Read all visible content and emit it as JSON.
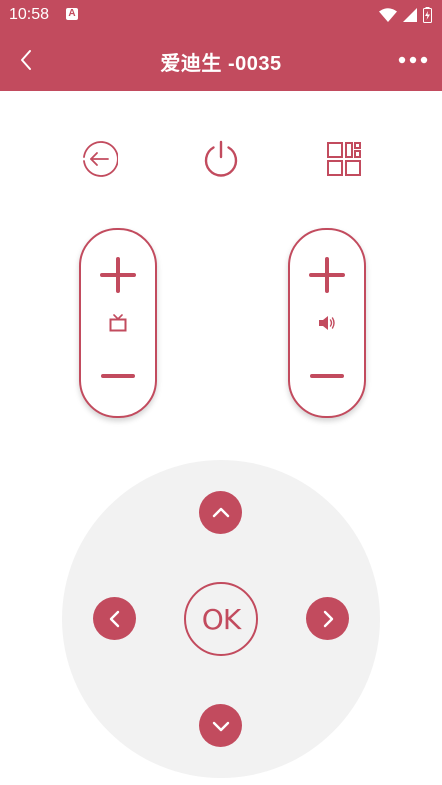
{
  "theme": {
    "accent": "#c24b5e",
    "background": "#ffffff",
    "dpad_background": "#f2f2f2"
  },
  "status_bar": {
    "time": "10:58",
    "notification_icon": "a-icon",
    "indicator_icons": [
      "wifi-icon",
      "signal-icon",
      "battery-icon"
    ]
  },
  "header": {
    "back_icon": "chevron-left-icon",
    "title": "爱迪生 -0035",
    "more_icon": "more-horizontal-icon"
  },
  "top_controls": [
    {
      "name": "return",
      "icon": "return-arrow-icon"
    },
    {
      "name": "power",
      "icon": "power-icon"
    },
    {
      "name": "menu",
      "icon": "apps-grid-icon"
    }
  ],
  "rockers": [
    {
      "name": "channel",
      "middle_icon": "tv-icon",
      "plus_icon": "plus-icon",
      "minus_icon": "minus-icon"
    },
    {
      "name": "volume",
      "middle_icon": "speaker-icon",
      "plus_icon": "plus-icon",
      "minus_icon": "minus-icon"
    }
  ],
  "dpad": {
    "ok_label": "OK",
    "up_icon": "chevron-up-icon",
    "down_icon": "chevron-down-icon",
    "left_icon": "chevron-left-icon",
    "right_icon": "chevron-right-icon"
  }
}
